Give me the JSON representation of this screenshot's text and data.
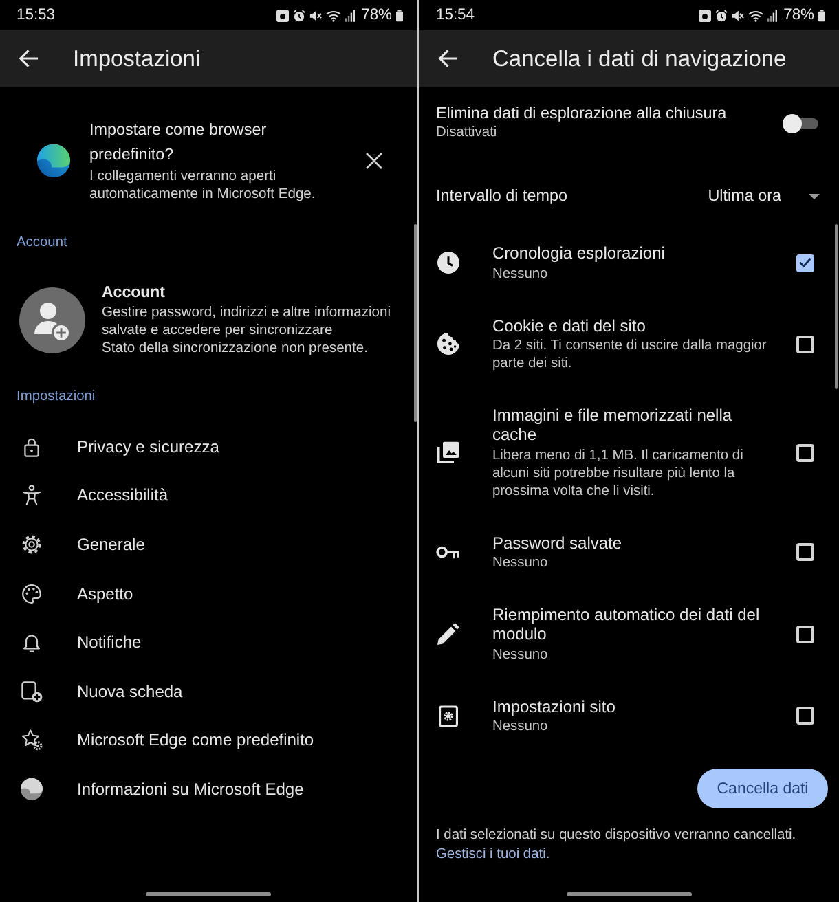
{
  "settings_screen": {
    "status_bar": {
      "time": "15:53",
      "battery": "78%"
    },
    "app_bar": {
      "title": "Impostazioni"
    },
    "default_browser_banner": {
      "title": "Impostare come browser predefinito?",
      "text": "I collegamenti verranno aperti automaticamente in Microsoft Edge."
    },
    "account_section": {
      "header": "Account",
      "name": "Account",
      "description": "Gestire password, indirizzi e altre informazioni salvate e accedere per sincronizzare",
      "sync_status": "Stato della sincronizzazione non presente."
    },
    "settings_section": {
      "header": "Impostazioni",
      "items": [
        "Privacy e sicurezza",
        "Accessibilità",
        "Generale",
        "Aspetto",
        "Notifiche",
        "Nuova scheda",
        "Microsoft Edge come predefinito",
        "Informazioni su Microsoft Edge"
      ]
    }
  },
  "clear_data_screen": {
    "status_bar": {
      "time": "15:54",
      "battery": "78%"
    },
    "app_bar": {
      "title": "Cancella i dati di navigazione"
    },
    "clear_on_exit": {
      "label": "Elimina dati di esplorazione alla chiusura",
      "status": "Disattivati",
      "on": false
    },
    "time_range": {
      "label": "Intervallo di tempo",
      "value": "Ultima ora"
    },
    "data_types": [
      {
        "title": "Cronologia esplorazioni",
        "detail": "Nessuno",
        "checked": true
      },
      {
        "title": "Cookie e dati del sito",
        "detail": "Da 2 siti. Ti consente di uscire dalla maggior parte dei siti.",
        "checked": false
      },
      {
        "title": "Immagini e file memorizzati nella cache",
        "detail": "Libera meno di 1,1 MB. Il caricamento di alcuni siti potrebbe risultare più lento la prossima volta che li visiti.",
        "checked": false
      },
      {
        "title": "Password salvate",
        "detail": "Nessuno",
        "checked": false
      },
      {
        "title": "Riempimento automatico dei dati del modulo",
        "detail": "Nessuno",
        "checked": false
      },
      {
        "title": "Impostazioni sito",
        "detail": "Nessuno",
        "checked": false
      }
    ],
    "clear_button": "Cancella dati",
    "footer": {
      "text": "I dati selezionati su questo dispositivo verranno cancellati.",
      "link": "Gestisci i tuoi dati."
    }
  }
}
